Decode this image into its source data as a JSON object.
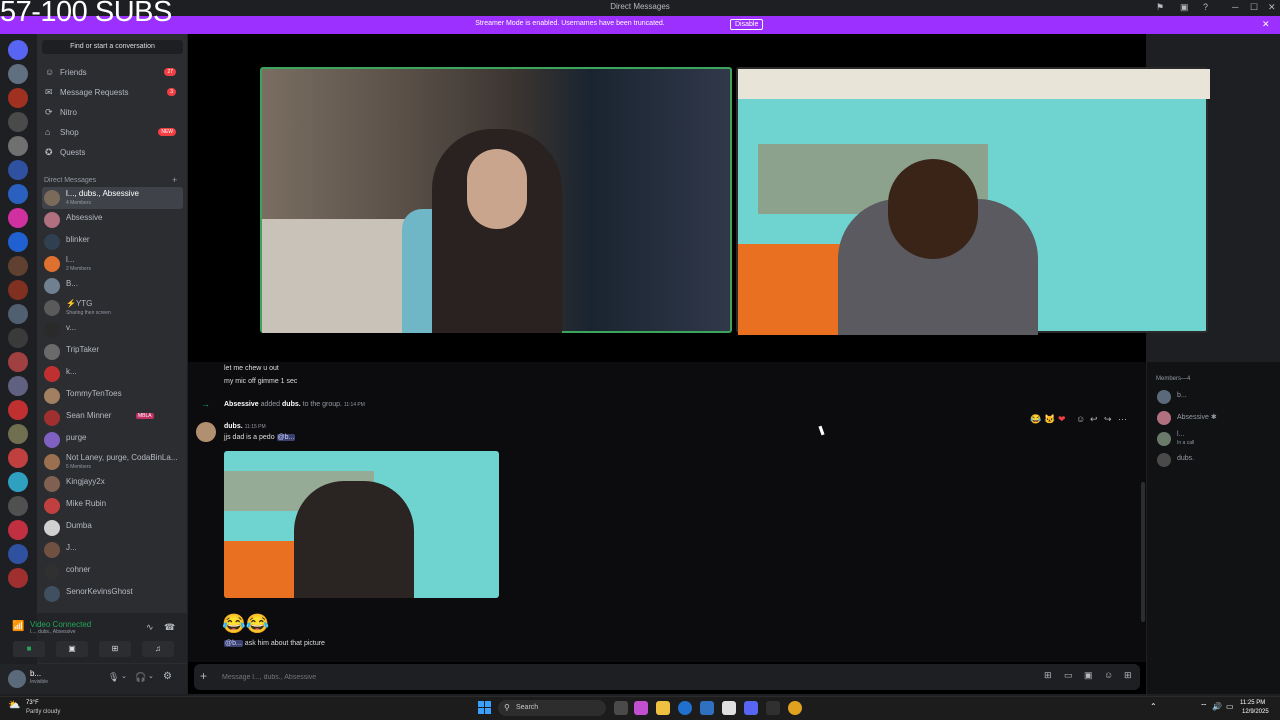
{
  "overlay": {
    "subs_text": "57-100 SUBS"
  },
  "window": {
    "title": "Direct Messages",
    "minimize": "─",
    "maximize": "☐",
    "close": "✕"
  },
  "banner": {
    "text": "Streamer Mode is enabled. Usernames have been truncated.",
    "button": "Disable",
    "close": "✕"
  },
  "sidebar": {
    "find": "Find or start a conversation",
    "nav": [
      {
        "label": "Friends",
        "icon": "friends-icon",
        "glyph": "☺",
        "badge": "27"
      },
      {
        "label": "Message Requests",
        "icon": "mail-icon",
        "glyph": "✉",
        "badge": "3"
      },
      {
        "label": "Nitro",
        "icon": "nitro-icon",
        "glyph": "⟳",
        "badge": ""
      },
      {
        "label": "Shop",
        "icon": "shop-icon",
        "glyph": "⌂",
        "badge": "NEW"
      },
      {
        "label": "Quests",
        "icon": "quests-icon",
        "glyph": "✪",
        "badge": ""
      }
    ],
    "dm_header": "Direct Messages",
    "dm_add": "+",
    "dms": [
      {
        "name": "l..., dubs., Absessive",
        "sub": "4 Members",
        "color": "#7a6a5a",
        "active": true
      },
      {
        "name": "Absessive",
        "sub": "",
        "color": "#b07080"
      },
      {
        "name": "blinker",
        "sub": "",
        "color": "#304050"
      },
      {
        "name": "l...",
        "sub": "2 Members",
        "color": "#e07030"
      },
      {
        "name": "B...",
        "sub": "",
        "color": "#708090"
      },
      {
        "name": "⚡YTG",
        "sub": "Sharing their screen",
        "color": "#5a5a5a"
      },
      {
        "name": "v...",
        "sub": "",
        "color": "#2a2a2a"
      },
      {
        "name": "TripTaker",
        "sub": "",
        "color": "#6a6a6a"
      },
      {
        "name": "k...",
        "sub": "",
        "color": "#c03030"
      },
      {
        "name": "TommyTenToes",
        "sub": "",
        "color": "#a08060"
      },
      {
        "name": "Sean Minner",
        "sub": "",
        "tag": "MBLA",
        "color": "#a03030"
      },
      {
        "name": "purge",
        "sub": "",
        "color": "#8060c0"
      },
      {
        "name": "Not Laney, purge, CodaBinLa...",
        "sub": "5 Members",
        "color": "#9a7050"
      },
      {
        "name": "Kingjayy2x",
        "sub": "",
        "color": "#806050"
      },
      {
        "name": "Mike Rubin",
        "sub": "",
        "color": "#c04040"
      },
      {
        "name": "Dumba",
        "sub": "",
        "color": "#d0d0d0"
      },
      {
        "name": "J...",
        "sub": "",
        "color": "#705040"
      },
      {
        "name": "cohner",
        "sub": "",
        "color": "#303030"
      },
      {
        "name": "SenorKevinsGhost",
        "sub": "",
        "color": "#405060"
      }
    ],
    "voice": {
      "status": "Video Connected",
      "channel": "l..., dubs., Absessive"
    },
    "user": {
      "name": "b...",
      "status": "Invisible"
    }
  },
  "chat": {
    "lines_top": [
      "let me chew u out",
      "my mic off gimme 1 sec"
    ],
    "system": {
      "actor": "Absessive",
      "verb": "added",
      "target": "dubs.",
      "rest": "to the group.",
      "time": "11:14 PM"
    },
    "message": {
      "author": "dubs.",
      "time": "11:15 PM",
      "text": "jjs dad is a pedo",
      "mention": "@b..."
    },
    "emoji_line": "😂😂",
    "reply": {
      "mention": "@b...",
      "text": "ask him about that picture"
    },
    "composer_placeholder": "Message l..., dubs., Absessive"
  },
  "reactions_toolbar": [
    "😂",
    "🐱",
    "❤",
    "☺",
    "↩",
    "↪",
    "⋯"
  ],
  "members": {
    "header": "Members—4",
    "list": [
      {
        "name": "b...",
        "sub": "",
        "color": "#5a6a7a"
      },
      {
        "name": "Absessive ✱",
        "sub": "",
        "color": "#b07080"
      },
      {
        "name": "l...",
        "sub": "In a call",
        "color": "#6a7a6a"
      },
      {
        "name": "dubs.",
        "sub": "",
        "color": "#4a4a4a"
      }
    ]
  },
  "taskbar": {
    "weather_temp": "73°F",
    "weather_desc": "Partly cloudy",
    "search": "Search",
    "time": "11:25 PM",
    "date": "12/9/2025"
  }
}
